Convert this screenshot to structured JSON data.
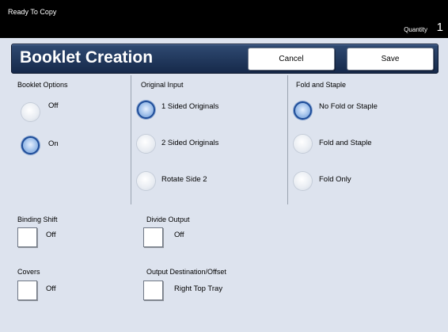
{
  "status": {
    "text": "Ready To Copy",
    "quantity_label": "Quantity",
    "quantity_value": "1"
  },
  "header": {
    "title": "Booklet Creation",
    "cancel_label": "Cancel",
    "save_label": "Save"
  },
  "booklet_options": {
    "heading": "Booklet Options",
    "options": [
      {
        "label": "Off",
        "selected": false
      },
      {
        "label": "On",
        "selected": true
      }
    ]
  },
  "original_input": {
    "heading": "Original Input",
    "options": [
      {
        "label": "1 Sided Originals",
        "selected": true
      },
      {
        "label": "2 Sided Originals",
        "selected": false
      },
      {
        "label": "Rotate Side 2",
        "selected": false
      }
    ]
  },
  "fold_staple": {
    "heading": "Fold and Staple",
    "options": [
      {
        "label": "No Fold or Staple",
        "selected": true
      },
      {
        "label": "Fold and Staple",
        "selected": false
      },
      {
        "label": "Fold Only",
        "selected": false
      }
    ]
  },
  "binding_shift": {
    "label": "Binding Shift",
    "value": "Off"
  },
  "divide_output": {
    "label": "Divide Output",
    "value": "Off"
  },
  "covers": {
    "label": "Covers",
    "value": "Off"
  },
  "output_destination": {
    "label": "Output Destination/Offset",
    "value": "Right Top Tray"
  }
}
